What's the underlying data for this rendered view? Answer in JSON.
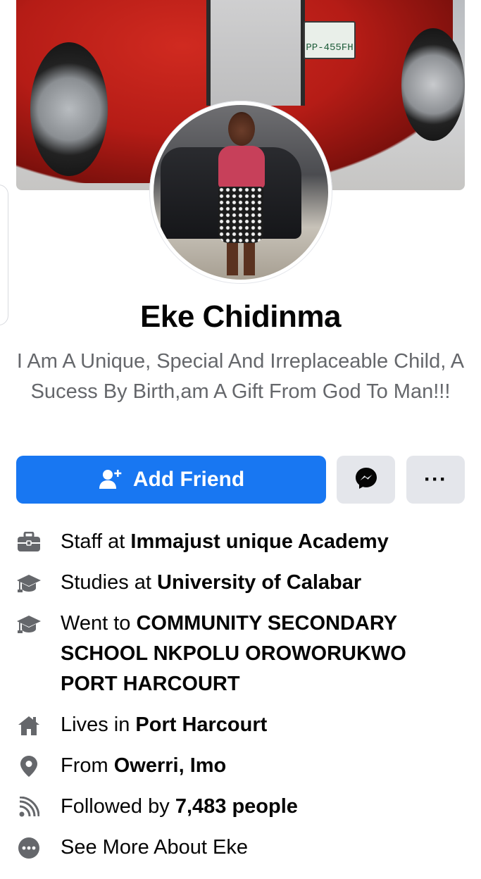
{
  "cover": {
    "plate_text": "PP-455FH"
  },
  "profile": {
    "name": "Eke Chidinma",
    "bio": "I Am A Unique, Special And Irreplaceable Child, A Sucess By Birth,am A Gift From God To Man!!!"
  },
  "actions": {
    "add_friend_label": "Add Friend",
    "more_label": "···"
  },
  "details": [
    {
      "icon": "briefcase-icon",
      "prefix": "Staff at ",
      "value": "Immajust unique Academy"
    },
    {
      "icon": "graduation-cap-icon",
      "prefix": "Studies at ",
      "value": "University of Calabar"
    },
    {
      "icon": "graduation-cap-icon",
      "prefix": "Went to ",
      "value": "COMMUNITY SECONDARY SCHOOL NKPOLU OROWORUKWO PORT HARCOURT"
    },
    {
      "icon": "home-icon",
      "prefix": "Lives in ",
      "value": "Port Harcourt"
    },
    {
      "icon": "location-pin-icon",
      "prefix": "From ",
      "value": "Owerri, Imo"
    },
    {
      "icon": "rss-feed-icon",
      "prefix": "Followed by ",
      "value": "7,483 people"
    },
    {
      "icon": "more-dots-icon",
      "prefix": "See More About Eke",
      "value": ""
    }
  ],
  "colors": {
    "primary": "#1877f2",
    "secondary_bg": "#e4e6eb",
    "muted_text": "#65676b",
    "icon_gray": "#65676b"
  }
}
